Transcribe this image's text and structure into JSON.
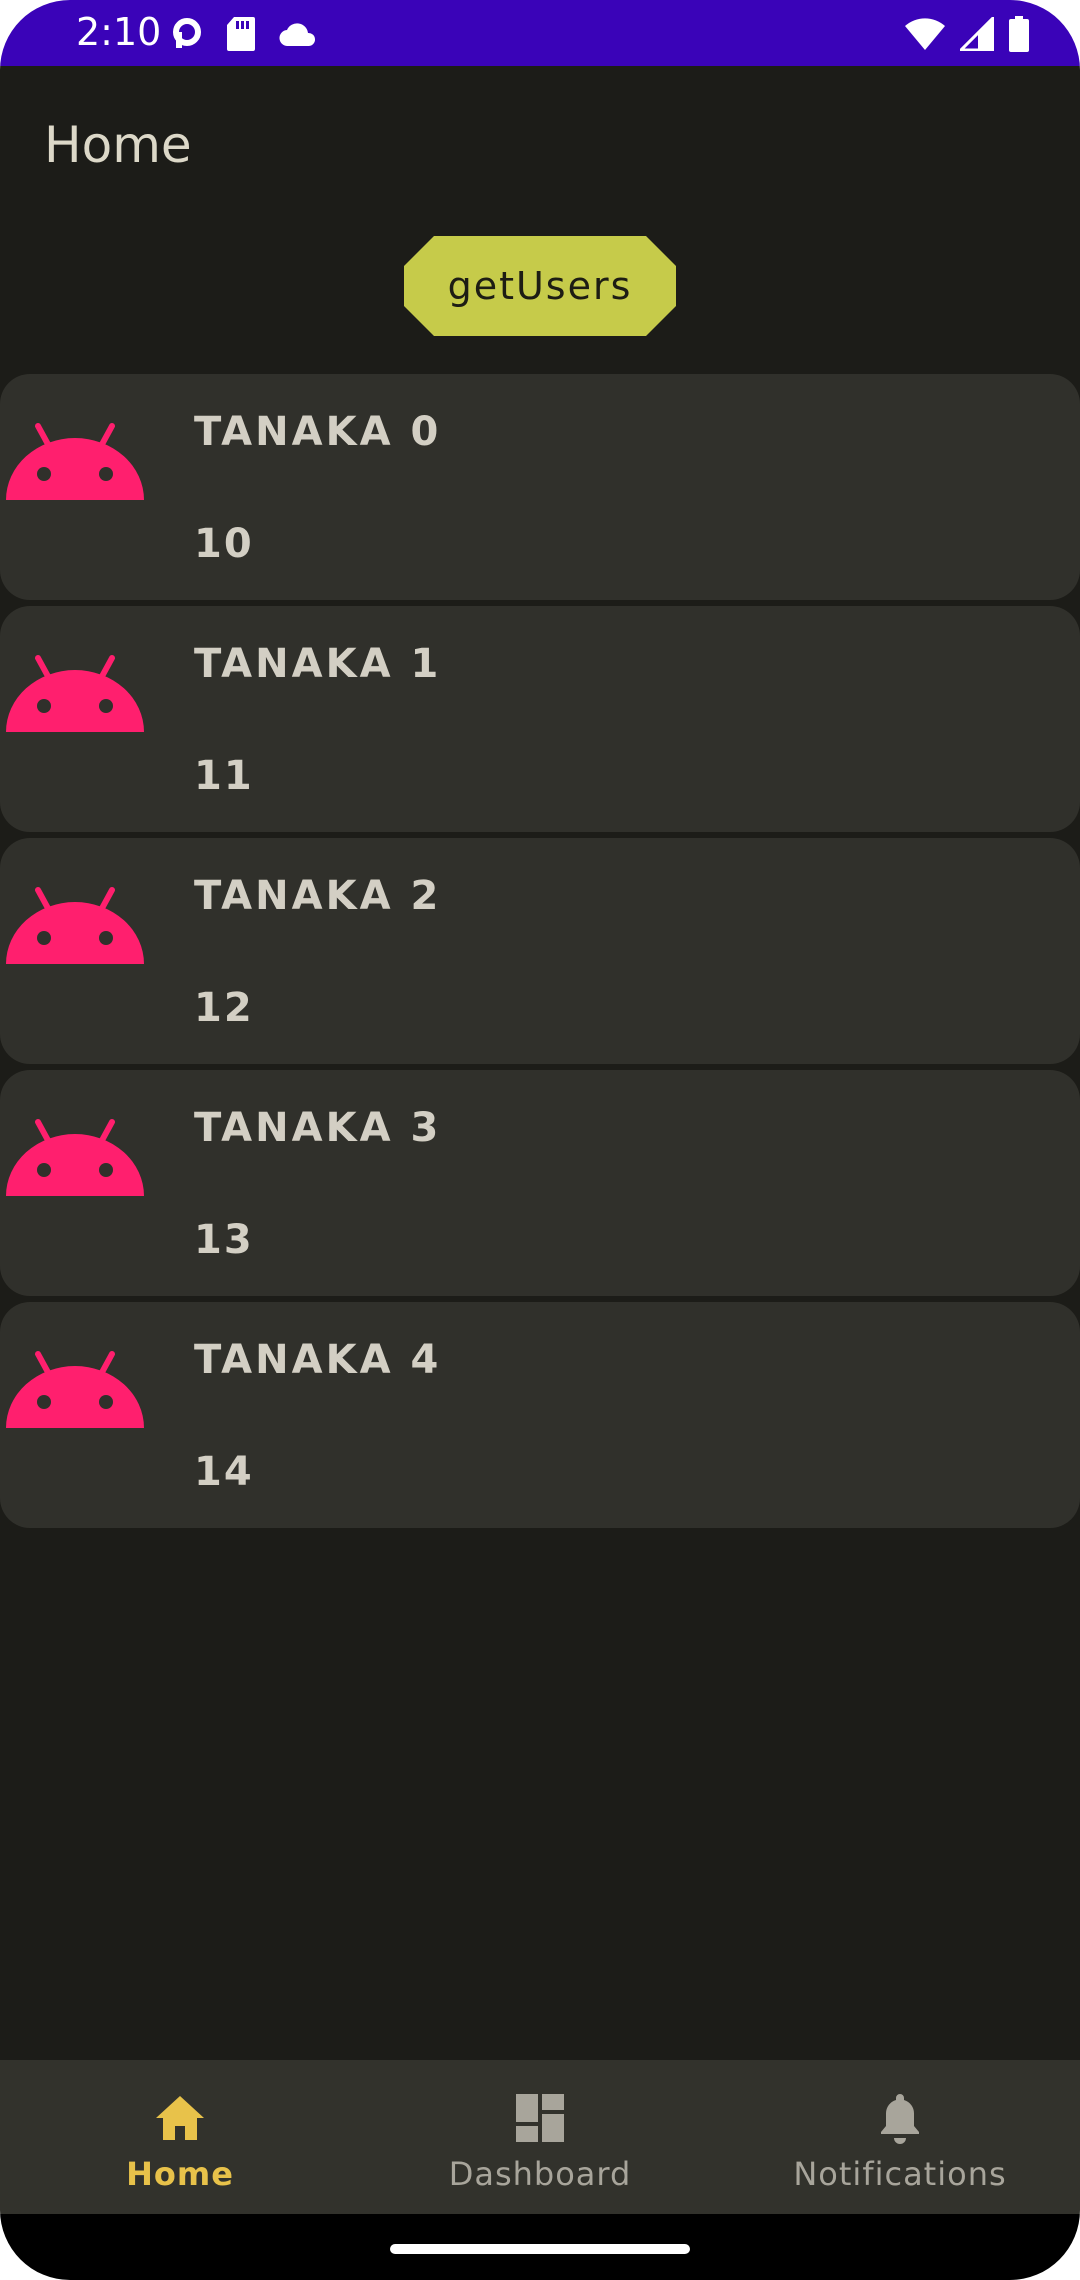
{
  "status_bar": {
    "time": "2:10",
    "icons_left": [
      "assistant-icon",
      "sd-card-icon",
      "cloud-icon"
    ],
    "icons_right": [
      "wifi-icon",
      "signal-icon",
      "battery-icon"
    ],
    "background": "#3a03b8"
  },
  "app_bar": {
    "title": "Home"
  },
  "actions": {
    "get_users_label": "getUsers",
    "button_color": "#c6cb4a"
  },
  "users": [
    {
      "name": "TANAKA 0",
      "value": "10",
      "avatar_icon": "android-icon"
    },
    {
      "name": "TANAKA 1",
      "value": "11",
      "avatar_icon": "android-icon"
    },
    {
      "name": "TANAKA 2",
      "value": "12",
      "avatar_icon": "android-icon"
    },
    {
      "name": "TANAKA 3",
      "value": "13",
      "avatar_icon": "android-icon"
    },
    {
      "name": "TANAKA 4",
      "value": "14",
      "avatar_icon": "android-icon"
    }
  ],
  "avatar_color": "#ff1f6e",
  "bottom_nav": {
    "items": [
      {
        "label": "Home",
        "icon": "home-icon",
        "active": true
      },
      {
        "label": "Dashboard",
        "icon": "dashboard-icon",
        "active": false
      },
      {
        "label": "Notifications",
        "icon": "bell-icon",
        "active": false
      }
    ],
    "active_color": "#e8c24a",
    "inactive_color": "#a8a59b"
  }
}
